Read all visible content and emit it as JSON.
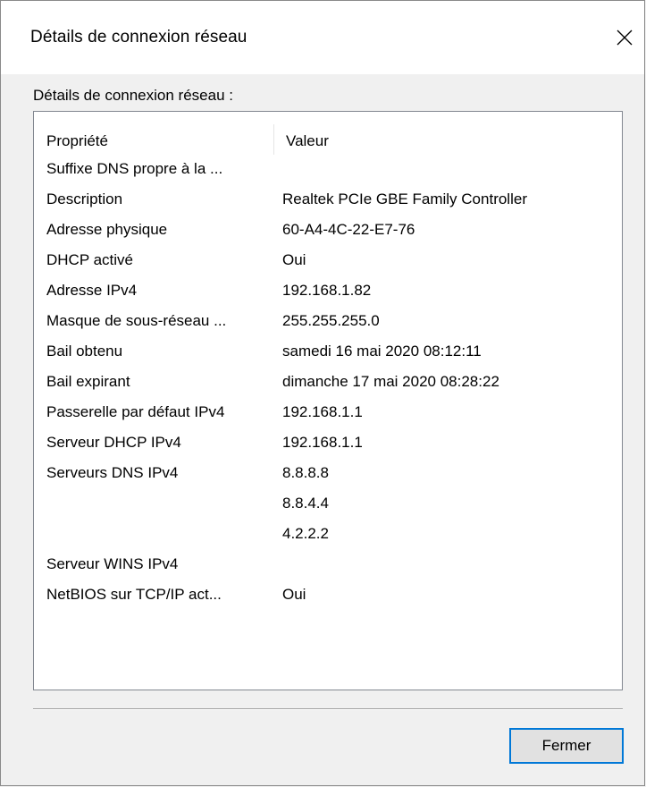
{
  "window": {
    "title": "Détails de connexion réseau",
    "close_icon": "close-icon"
  },
  "section_label": "Détails de connexion réseau :",
  "columns": {
    "property": "Propriété",
    "value": "Valeur"
  },
  "rows": [
    {
      "property": "Suffixe DNS propre à la ...",
      "value": ""
    },
    {
      "property": "Description",
      "value": "Realtek PCIe GBE Family Controller"
    },
    {
      "property": "Adresse physique",
      "value": "60-A4-4C-22-E7-76"
    },
    {
      "property": "DHCP activé",
      "value": "Oui"
    },
    {
      "property": "Adresse IPv4",
      "value": "192.168.1.82"
    },
    {
      "property": "Masque de sous-réseau ...",
      "value": "255.255.255.0"
    },
    {
      "property": "Bail obtenu",
      "value": "samedi 16 mai 2020 08:12:11"
    },
    {
      "property": "Bail expirant",
      "value": "dimanche 17 mai 2020 08:28:22"
    },
    {
      "property": "Passerelle par défaut IPv4",
      "value": "192.168.1.1"
    },
    {
      "property": "Serveur DHCP IPv4",
      "value": "192.168.1.1"
    },
    {
      "property": "Serveurs DNS IPv4",
      "value": "8.8.8.8"
    },
    {
      "property": "",
      "value": "8.8.4.4"
    },
    {
      "property": "",
      "value": "4.2.2.2"
    },
    {
      "property": "Serveur WINS IPv4",
      "value": ""
    },
    {
      "property": "NetBIOS sur TCP/IP act...",
      "value": "Oui"
    }
  ],
  "buttons": {
    "close_label": "Fermer"
  },
  "colors": {
    "focus_border": "#0078d7",
    "dialog_bg": "#f0f0f0",
    "list_bg": "#ffffff"
  }
}
